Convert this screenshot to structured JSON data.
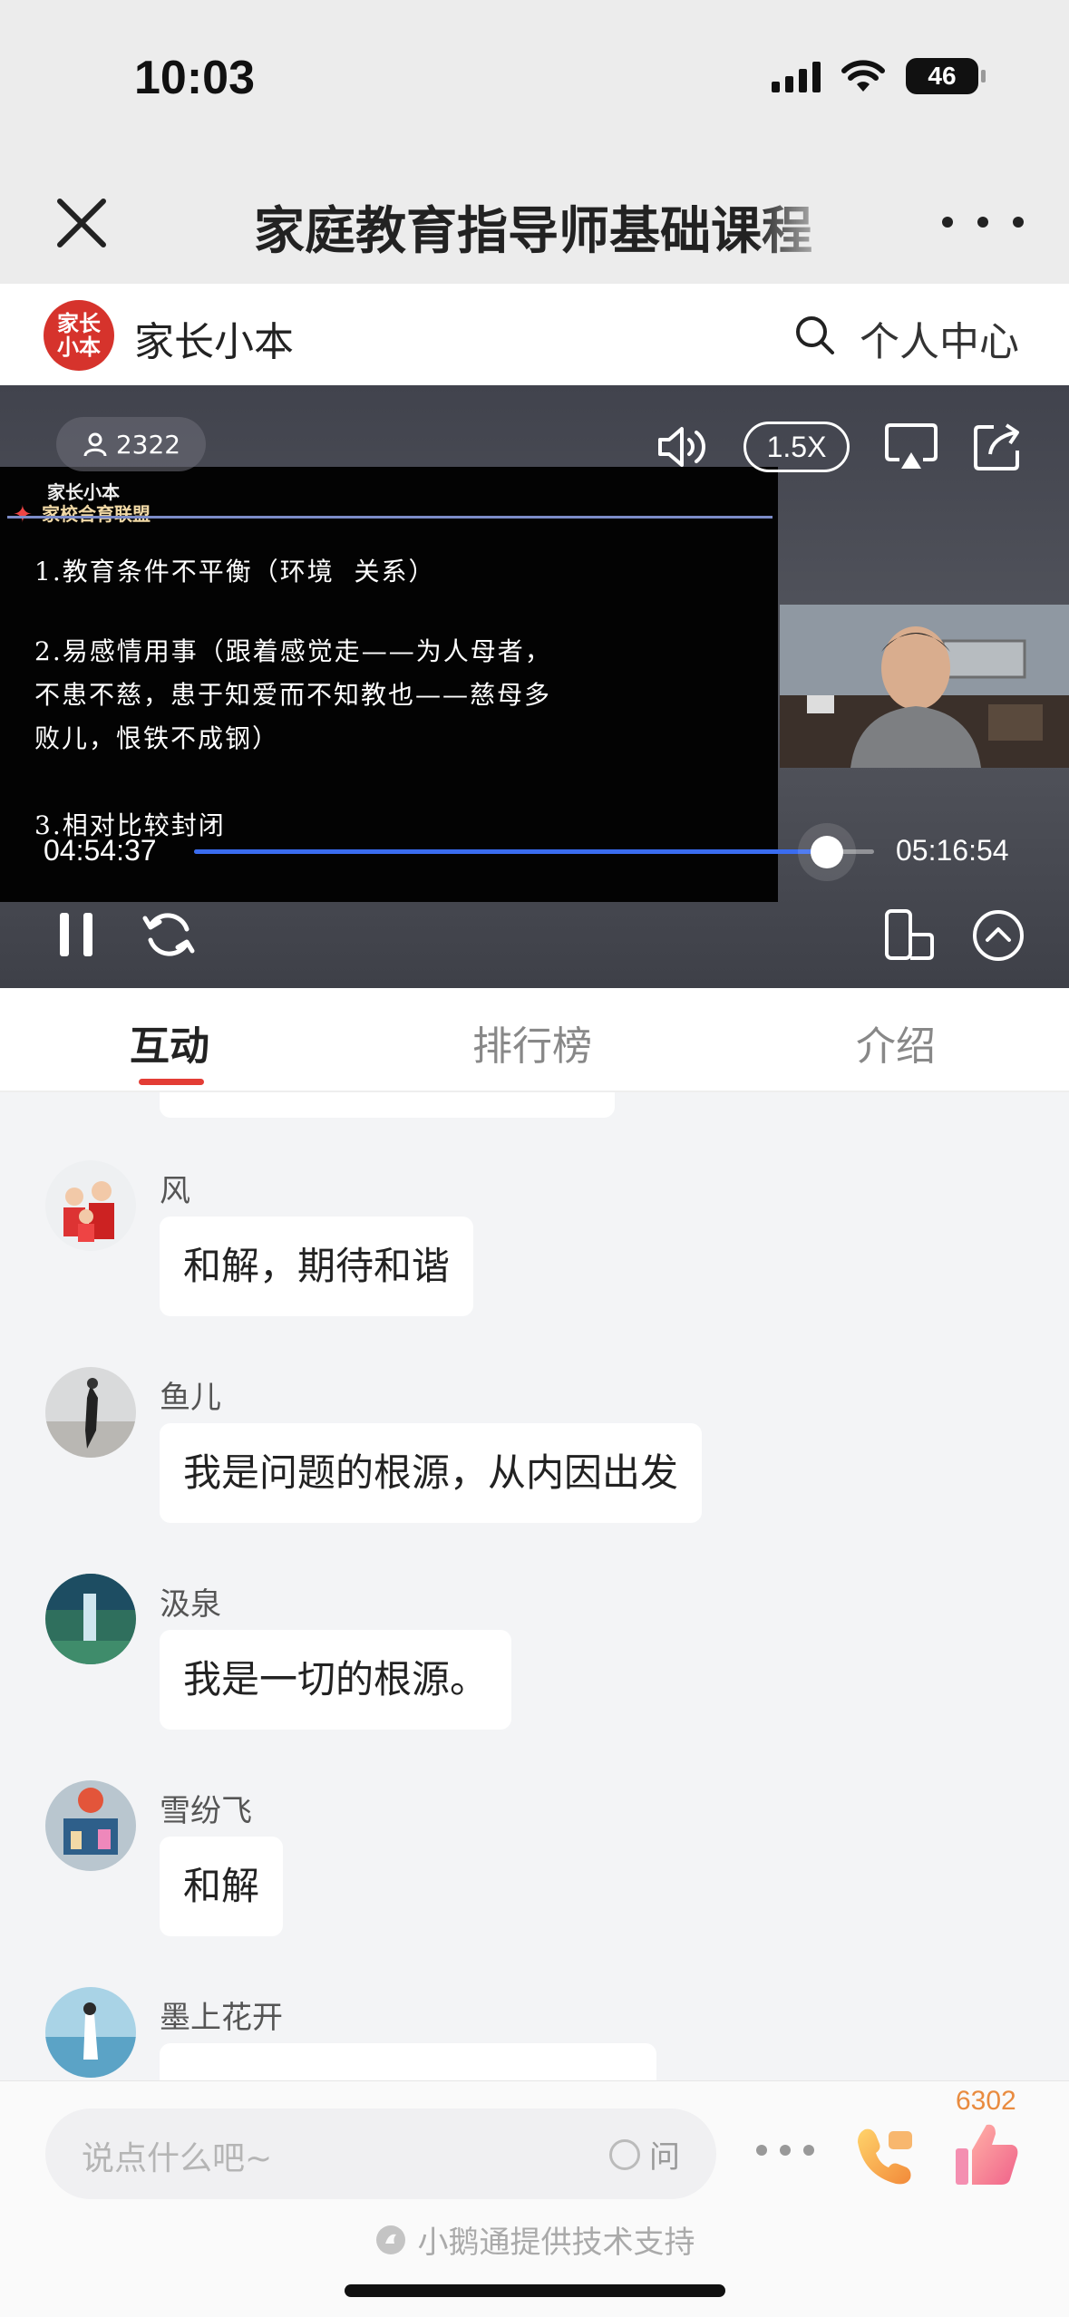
{
  "status_bar": {
    "time": "10:03",
    "battery": "46"
  },
  "title_bar": {
    "title": "家庭教育指导师基础课程"
  },
  "header": {
    "logo_text_1": "家长",
    "logo_text_2": "小本",
    "brand": "家长小本",
    "personal_center": "个人中心"
  },
  "player": {
    "viewers": "2322",
    "speed": "1.5X",
    "current_time": "04:54:37",
    "total_time": "05:16:54",
    "progress": 0.93,
    "slide": {
      "brand": "家长小本",
      "sub_brand": "家校合育联盟",
      "line1": "1.教育条件不平衡（环境  关系）",
      "line2": "2.易感情用事（跟着感觉走——为人母者，\n不患不慈，患于知爱而不知教也——慈母多\n败儿，恨铁不成钢）",
      "line3": "3.相对比较封闭"
    }
  },
  "tabs": [
    {
      "label": "互动",
      "active": true
    },
    {
      "label": "排行榜",
      "active": false
    },
    {
      "label": "介绍",
      "active": false
    }
  ],
  "comments": [
    {
      "name": "风",
      "text": "和解，期待和谐"
    },
    {
      "name": "鱼儿",
      "text": "我是问题的根源，从内因出发"
    },
    {
      "name": "汲泉",
      "text": "我是一切的根源。"
    },
    {
      "name": "雪纷飞",
      "text": "和解"
    },
    {
      "name": "墨上花开",
      "text": ""
    }
  ],
  "bottom": {
    "input_placeholder": "说点什么吧~",
    "ask_label": "问",
    "like_count": "6302",
    "footer": "小鹅通提供技术支持"
  },
  "colors": {
    "accent": "#e33d35",
    "progress": "#3a6cf0",
    "like": "#e98b3f"
  }
}
